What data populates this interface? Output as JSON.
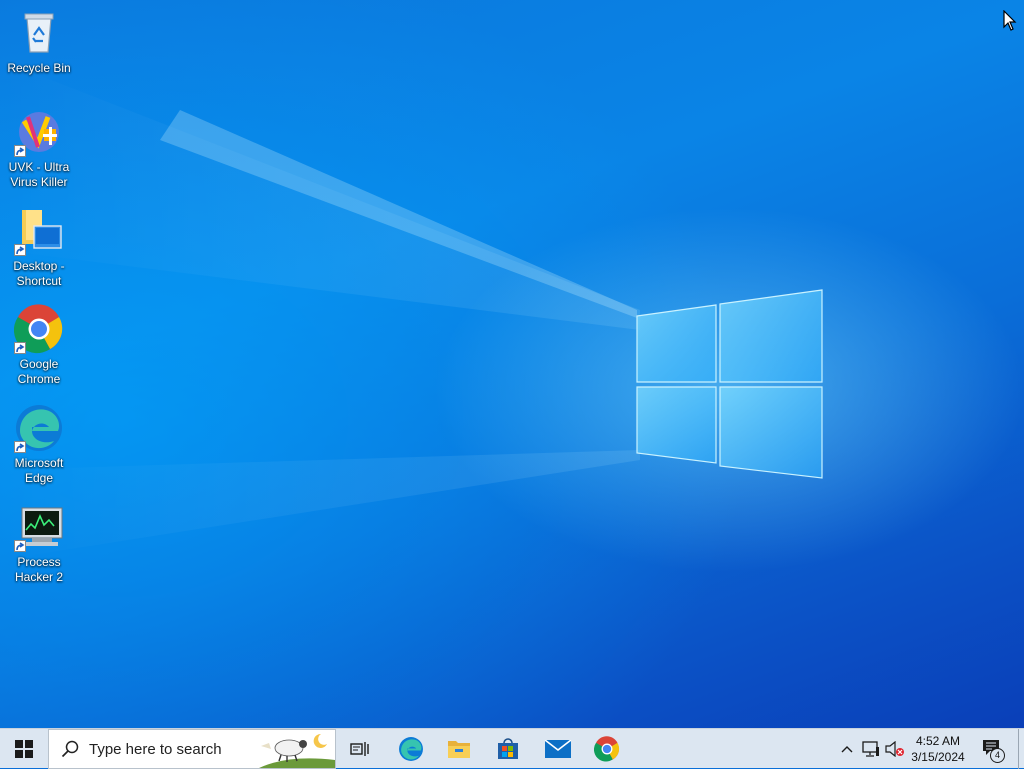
{
  "desktop": {
    "icons": [
      {
        "label": "Recycle Bin"
      },
      {
        "label": "UVK - Ultra Virus Killer"
      },
      {
        "label": "Desktop - Shortcut"
      },
      {
        "label": "Google Chrome"
      },
      {
        "label": "Microsoft Edge"
      },
      {
        "label": "Process Hacker 2"
      }
    ]
  },
  "taskbar": {
    "search_placeholder": "Type here to search",
    "pinned": [
      "start-icon",
      "task-view-icon",
      "edge-icon",
      "file-explorer-icon",
      "store-icon",
      "mail-icon",
      "chrome-icon"
    ],
    "tray": {
      "time": "4:52 AM",
      "date": "3/15/2024",
      "notification_count": "4"
    }
  },
  "colors": {
    "accent": "#0a78d7",
    "taskbar": "#dce6f1"
  }
}
